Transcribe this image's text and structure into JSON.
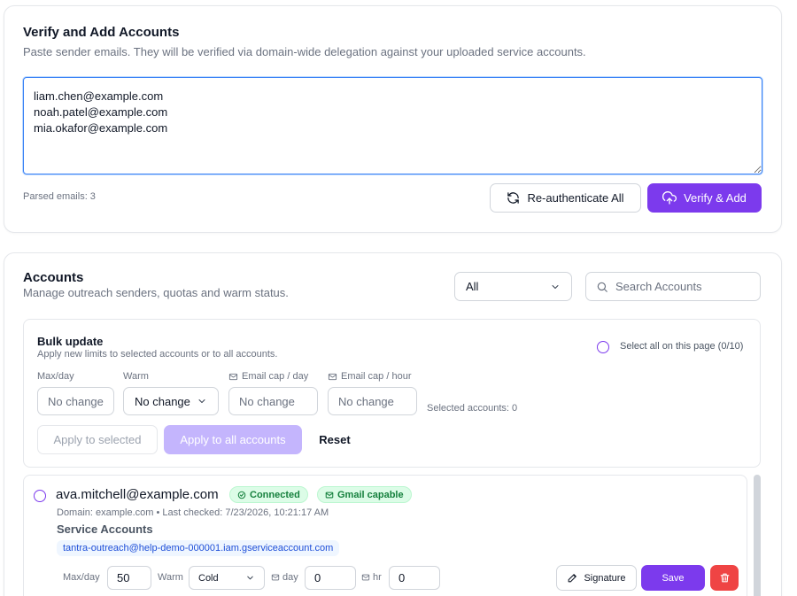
{
  "verify": {
    "title": "Verify and Add Accounts",
    "subtitle": "Paste sender emails. They will be verified via domain-wide delegation against your uploaded service accounts.",
    "emails_text": "liam.chen@example.com\nnoah.patel@example.com\nmia.okafor@example.com",
    "parsed_label": "Parsed emails: 3",
    "reauth_label": "Re-authenticate All",
    "verify_add_label": "Verify & Add"
  },
  "accounts": {
    "title": "Accounts",
    "subtitle": "Manage outreach senders, quotas and warm status.",
    "filter_value": "All",
    "search_placeholder": "Search Accounts",
    "bulk": {
      "title": "Bulk update",
      "subtitle": "Apply new limits to selected accounts or to all accounts.",
      "select_all_label": "Select all on this page (0/10)",
      "maxday_label": "Max/day",
      "maxday_placeholder": "No change",
      "warm_label": "Warm",
      "warm_value": "No change",
      "cap_day_label": "Email cap / day",
      "cap_day_placeholder": "No change",
      "cap_hour_label": "Email cap / hour",
      "cap_hour_placeholder": "No change",
      "selected_count": "Selected accounts: 0",
      "apply_selected_label": "Apply to selected",
      "apply_all_label": "Apply to all accounts",
      "reset_label": "Reset"
    },
    "items": [
      {
        "email": "ava.mitchell@example.com",
        "status_badge": "Connected",
        "gmail_badge": "Gmail capable",
        "meta": "Domain: example.com • Last checked: 7/23/2026, 10:21:17 AM",
        "service_accounts_label": "Service Accounts",
        "service_account": "tantra-outreach@help-demo-000001.iam.gserviceaccount.com",
        "maxday_label": "Max/day",
        "maxday_value": "50",
        "warm_label": "Warm",
        "warm_value": "Cold",
        "day_label": "day",
        "day_value": "0",
        "hr_label": "hr",
        "hr_value": "0",
        "signature_label": "Signature",
        "save_label": "Save"
      }
    ]
  },
  "colors": {
    "primary": "#7c3aed",
    "primary_soft": "#c4b5fd",
    "success": "#15803d",
    "danger": "#ef4444"
  },
  "icons": [
    "refresh-icon",
    "cloud-upload-icon",
    "chevron-down-icon",
    "search-icon",
    "mail-icon",
    "check-circle-icon",
    "pen-icon",
    "trash-icon"
  ]
}
